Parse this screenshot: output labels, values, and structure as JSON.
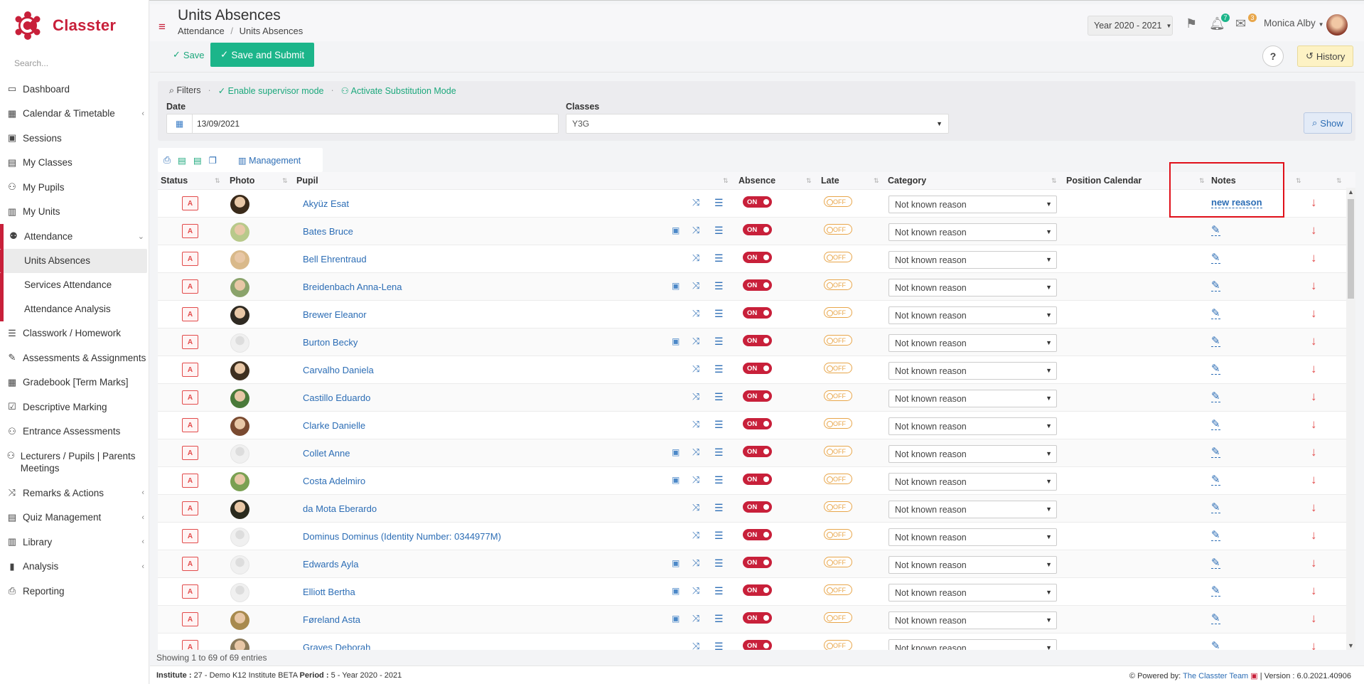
{
  "app": {
    "name": "Classter",
    "search_placeholder": "Search..."
  },
  "sidebar": {
    "items": [
      {
        "label": "Dashboard",
        "icon": "laptop-icon"
      },
      {
        "label": "Calendar & Timetable",
        "icon": "calendar-icon"
      },
      {
        "label": "Sessions",
        "icon": "presentation-icon"
      },
      {
        "label": "My Classes",
        "icon": "classroom-icon"
      },
      {
        "label": "My Pupils",
        "icon": "users-icon"
      },
      {
        "label": "My Units",
        "icon": "book-icon"
      },
      {
        "label": "Attendance",
        "icon": "user-check-icon"
      },
      {
        "label": "Classwork / Homework",
        "icon": "list-icon"
      },
      {
        "label": "Assessments & Assignments",
        "icon": "edit-icon"
      },
      {
        "label": "Gradebook [Term Marks]",
        "icon": "gradebook-icon"
      },
      {
        "label": "Descriptive Marking",
        "icon": "check-square-icon"
      },
      {
        "label": "Entrance Assessments",
        "icon": "user-edit-icon"
      },
      {
        "label": "Lecturers / Pupils | Parents Meetings",
        "icon": "users-icon"
      },
      {
        "label": "Remarks & Actions",
        "icon": "shuffle-icon"
      },
      {
        "label": "Quiz Management",
        "icon": "clipboard-icon"
      },
      {
        "label": "Library",
        "icon": "library-icon"
      },
      {
        "label": "Analysis",
        "icon": "bar-chart-icon"
      },
      {
        "label": "Reporting",
        "icon": "print-icon"
      }
    ],
    "attendance_sub": [
      "Units Absences",
      "Services Attendance",
      "Attendance Analysis"
    ]
  },
  "header": {
    "title": "Units Absences",
    "breadcrumb": [
      "Attendance",
      "/",
      "Units Absences"
    ],
    "year": "Year 2020 - 2021",
    "bell_count": "7",
    "mail_count": "3",
    "user": "Monica Alby"
  },
  "toolbar": {
    "save": "Save",
    "save_submit": "Save and Submit",
    "help": "?",
    "history": "History"
  },
  "filters": {
    "title": "Filters",
    "supervisor": "Enable supervisor mode",
    "substitution": "Activate Substitution Mode",
    "date_label": "Date",
    "date_value": "13/09/2021",
    "classes_label": "Classes",
    "classes_value": "Y3G",
    "show": "Show"
  },
  "tools": {
    "management": "Management"
  },
  "table": {
    "headers": {
      "status": "Status",
      "photo": "Photo",
      "pupil": "Pupil",
      "absence": "Absence",
      "late": "Late",
      "category": "Category",
      "position": "Position Calendar",
      "notes": "Notes"
    },
    "status_label": "A",
    "on_label": "ON",
    "off_label": "OFF",
    "category_value": "Not known reason",
    "new_reason": "new reason",
    "rows": [
      {
        "name": "Akyüz Esat",
        "bus": false,
        "photo": "#3a2a1a"
      },
      {
        "name": "Bates Bruce",
        "bus": true,
        "photo": "#b8c98a"
      },
      {
        "name": "Bell Ehrentraud",
        "bus": false,
        "photo": "#d9b98a"
      },
      {
        "name": "Breidenbach Anna-Lena",
        "bus": true,
        "photo": "#8aa36b"
      },
      {
        "name": "Brewer Eleanor",
        "bus": false,
        "photo": "#2f2a22"
      },
      {
        "name": "Burton Becky",
        "bus": true,
        "photo": ""
      },
      {
        "name": "Carvalho Daniela",
        "bus": false,
        "photo": "#3e3020"
      },
      {
        "name": "Castillo Eduardo",
        "bus": false,
        "photo": "#4a7a3a"
      },
      {
        "name": "Clarke Danielle",
        "bus": false,
        "photo": "#7a4a30"
      },
      {
        "name": "Collet Anne",
        "bus": true,
        "photo": ""
      },
      {
        "name": "Costa Adelmiro",
        "bus": true,
        "photo": "#7aa052"
      },
      {
        "name": "da Mota Eberardo",
        "bus": false,
        "photo": "#2a2a1e"
      },
      {
        "name": "Dominus Dominus (Identity Number: 0344977M)",
        "bus": false,
        "photo": ""
      },
      {
        "name": "Edwards Ayla",
        "bus": true,
        "photo": ""
      },
      {
        "name": "Elliott Bertha",
        "bus": true,
        "photo": ""
      },
      {
        "name": "Føreland Asta",
        "bus": true,
        "photo": "#a88a4e"
      },
      {
        "name": "Graves Deborah",
        "bus": false,
        "photo": "#8a7a5a"
      }
    ]
  },
  "entries": "Showing 1 to 69 of 69 entries",
  "footer": {
    "institute_label": "Institute :",
    "institute_value": "27 - Demo K12 Institute BETA",
    "period_label": "Period :",
    "period_value": "5 - Year 2020 - 2021",
    "powered": "Powered by:",
    "team": "The Classter Team",
    "version": "| Version : 6.0.2021.40906"
  }
}
